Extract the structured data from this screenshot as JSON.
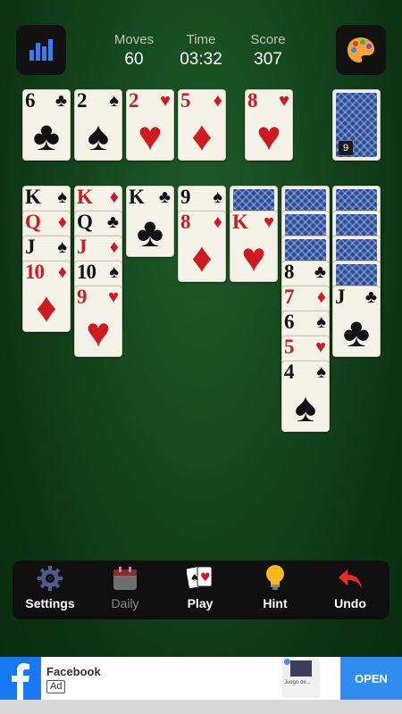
{
  "header": {
    "stats_icon": "bar-chart-icon",
    "theme_icon": "palette-icon",
    "moves_label": "Moves",
    "moves_value": "60",
    "time_label": "Time",
    "time_value": "03:32",
    "score_label": "Score",
    "score_value": "307"
  },
  "foundations": [
    {
      "rank": "6",
      "suit": "♣",
      "color": "black"
    },
    {
      "rank": "2",
      "suit": "♠",
      "color": "black"
    },
    {
      "rank": "2",
      "suit": "♥",
      "color": "red"
    },
    {
      "rank": "5",
      "suit": "♦",
      "color": "red"
    }
  ],
  "waste": {
    "rank": "8",
    "suit": "♥",
    "color": "red"
  },
  "stock": {
    "count": "9"
  },
  "tableau": [
    {
      "face_down": 0,
      "cards": [
        {
          "rank": "K",
          "suit": "♠",
          "color": "black"
        },
        {
          "rank": "Q",
          "suit": "♦",
          "color": "red"
        },
        {
          "rank": "J",
          "suit": "♠",
          "color": "black"
        },
        {
          "rank": "10",
          "suit": "♦",
          "color": "red"
        }
      ]
    },
    {
      "face_down": 0,
      "cards": [
        {
          "rank": "K",
          "suit": "♦",
          "color": "red"
        },
        {
          "rank": "Q",
          "suit": "♣",
          "color": "black"
        },
        {
          "rank": "J",
          "suit": "♦",
          "color": "red"
        },
        {
          "rank": "10",
          "suit": "♠",
          "color": "black"
        },
        {
          "rank": "9",
          "suit": "♥",
          "color": "red"
        }
      ]
    },
    {
      "face_down": 0,
      "cards": [
        {
          "rank": "K",
          "suit": "♣",
          "color": "black"
        }
      ]
    },
    {
      "face_down": 0,
      "cards": [
        {
          "rank": "9",
          "suit": "♠",
          "color": "black"
        },
        {
          "rank": "8",
          "suit": "♦",
          "color": "red"
        }
      ]
    },
    {
      "face_down": 1,
      "cards": [
        {
          "rank": "K",
          "suit": "♥",
          "color": "red"
        }
      ]
    },
    {
      "face_down": 3,
      "cards": [
        {
          "rank": "8",
          "suit": "♣",
          "color": "black"
        },
        {
          "rank": "7",
          "suit": "♦",
          "color": "red"
        },
        {
          "rank": "6",
          "suit": "♠",
          "color": "black"
        },
        {
          "rank": "5",
          "suit": "♥",
          "color": "red"
        },
        {
          "rank": "4",
          "suit": "♠",
          "color": "black"
        }
      ]
    },
    {
      "face_down": 4,
      "cards": [
        {
          "rank": "J",
          "suit": "♣",
          "color": "black"
        }
      ]
    }
  ],
  "toolbar": [
    {
      "label": "Settings",
      "icon": "gear-icon",
      "enabled": true
    },
    {
      "label": "Daily",
      "icon": "calendar-icon",
      "enabled": false
    },
    {
      "label": "Play",
      "icon": "cards-icon",
      "enabled": true
    },
    {
      "label": "Hint",
      "icon": "lightbulb-icon",
      "enabled": true
    },
    {
      "label": "Undo",
      "icon": "undo-arrow-icon",
      "enabled": true
    }
  ],
  "ad": {
    "brand": "Facebook",
    "badge": "Ad",
    "cta": "OPEN",
    "thumb_text": "Juego de..."
  },
  "colors": {
    "felt": "#164a20",
    "red_suit": "#d01a22",
    "card_face": "#f5f2e8",
    "card_back": "#2a4c9c",
    "facebook_blue": "#1877f2"
  }
}
